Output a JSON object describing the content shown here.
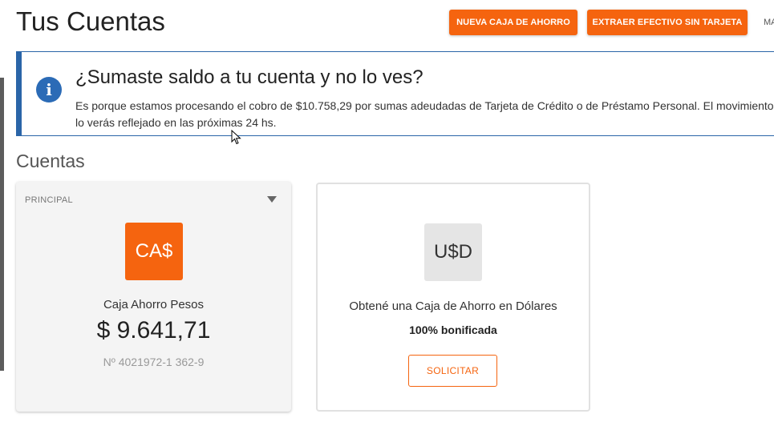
{
  "header": {
    "title": "Tus Cuentas",
    "new_account_button": "NUEVA CAJA DE AHORRO",
    "cardless_cash_button": "EXTRAER EFECTIVO SIN TARJETA",
    "more_button": "MA"
  },
  "alert": {
    "icon": "info-icon",
    "icon_glyph": "i",
    "title": "¿Sumaste saldo a tu cuenta y no lo ves?",
    "message": "Es porque estamos procesando el cobro de $10.758,29 por sumas adeudadas de Tarjeta de Crédito o de Préstamo Personal. El movimiento lo verás reflejado en las próximas 24 hs."
  },
  "accounts": {
    "section_title": "Cuentas",
    "main_card": {
      "tag": "PRINCIPAL",
      "currency_badge": "CA$",
      "name": "Caja Ahorro Pesos",
      "balance": "$ 9.641,71",
      "number": "Nº 4021972-1 362-9"
    },
    "usd_offer_card": {
      "currency_badge": "U$D",
      "offer_text": "Obtené una Caja de Ahorro en Dólares",
      "bonus_text": "100% bonificada",
      "request_button": "SOLICITAR"
    }
  },
  "colors": {
    "accent": "#f5640f",
    "info": "#2b6bb6",
    "card_background": "#f4f4f4"
  }
}
